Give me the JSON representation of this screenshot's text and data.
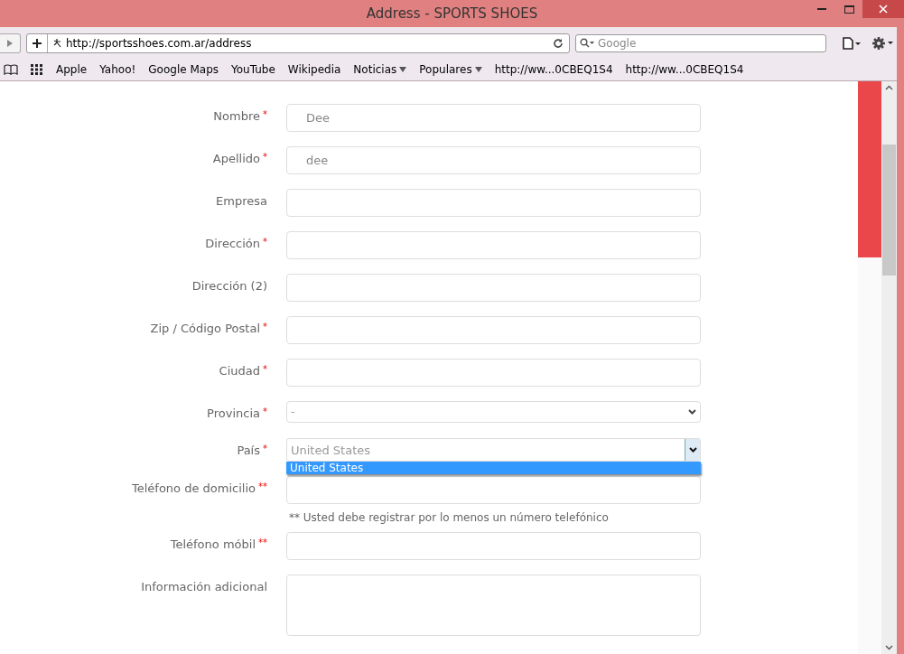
{
  "window": {
    "title": "Address - SPORTS SHOES"
  },
  "toolbar": {
    "url": "http://sportsshoes.com.ar/address",
    "search_placeholder": "Google"
  },
  "bookmarks": [
    {
      "label": "Apple",
      "menu": false
    },
    {
      "label": "Yahoo!",
      "menu": false
    },
    {
      "label": "Google Maps",
      "menu": false
    },
    {
      "label": "YouTube",
      "menu": false
    },
    {
      "label": "Wikipedia",
      "menu": false
    },
    {
      "label": "Noticias",
      "menu": true
    },
    {
      "label": "Populares",
      "menu": true
    },
    {
      "label": "http://ww...0CBEQ1S4",
      "menu": false
    },
    {
      "label": "http://ww...0CBEQ1S4",
      "menu": false
    }
  ],
  "form": {
    "fields": [
      {
        "kind": "input",
        "label": "Nombre",
        "marker": "*",
        "value": "Dee"
      },
      {
        "kind": "input",
        "label": "Apellido",
        "marker": "*",
        "value": "dee"
      },
      {
        "kind": "input",
        "label": "Empresa"
      },
      {
        "kind": "input",
        "label": "Dirección",
        "marker": "*"
      },
      {
        "kind": "input",
        "label": "Dirección (2)"
      },
      {
        "kind": "input",
        "label": "Zip / Código Postal",
        "marker": "*"
      },
      {
        "kind": "input",
        "label": "Ciudad",
        "marker": "*"
      },
      {
        "kind": "select",
        "label": "Provincia",
        "marker": "*",
        "value": "-"
      },
      {
        "kind": "open-select",
        "label": "País",
        "marker": "*",
        "value": "United States",
        "option": "United States"
      },
      {
        "kind": "input",
        "label": "Teléfono de domicilio",
        "marker": "**"
      },
      {
        "kind": "note",
        "text": "** Usted debe registrar por lo menos un número telefónico"
      },
      {
        "kind": "input",
        "label": "Teléfono móbil",
        "marker": "**"
      },
      {
        "kind": "textarea",
        "label": "Información adicional"
      }
    ]
  }
}
